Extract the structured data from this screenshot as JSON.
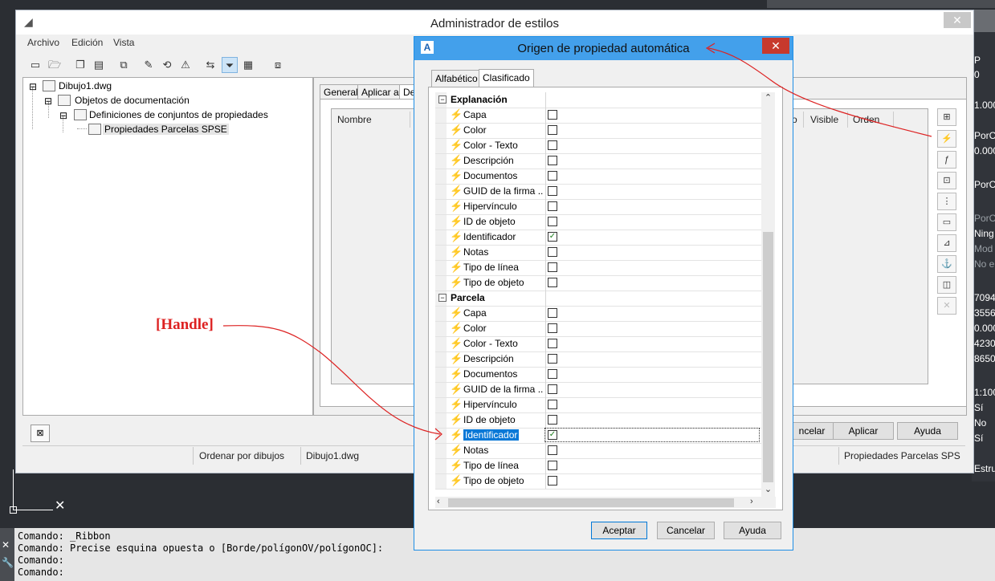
{
  "style_manager": {
    "title": "Administrador de estilos",
    "close_glyph": "✕",
    "menu": [
      "Archivo",
      "Edición",
      "Vista"
    ],
    "toolbar_icons": [
      "new-icon",
      "open-icon",
      "copy-icon",
      "paste-icon",
      "purge-icon",
      "edit-icon",
      "sync-icon",
      "warning-icon",
      "compare-icon",
      "filter-icon",
      "view-options-icon",
      "help-window-icon"
    ],
    "tree": {
      "root": "Dibujo1.dwg",
      "child": "Objetos de documentación",
      "grandchild": "Definiciones de conjuntos de propiedades",
      "selected": "Propiedades Parcelas SPSE"
    },
    "tabs": [
      "General",
      "Aplicar a",
      "De"
    ],
    "grid_headers": {
      "nombre": "Nombre",
      "o": "o",
      "visible": "Visible",
      "orden": "Orden"
    },
    "buttons": {
      "cancel": "ncelar",
      "apply": "Aplicar",
      "help": "Ayuda"
    },
    "status": {
      "sort": "Ordenar por dibujos",
      "file": "Dibujo1.dwg",
      "style": "Propiedades Parcelas SPS"
    }
  },
  "dialog": {
    "title": "Origen de propiedad automática",
    "app_icon_letter": "A",
    "close_glyph": "✕",
    "tabs": [
      "Alfabético",
      "Clasificado"
    ],
    "active_tab": "Clasificado",
    "categories": [
      {
        "name": "Explanación",
        "expander": "−",
        "items": [
          {
            "label": "Capa",
            "mark": ""
          },
          {
            "label": "Color",
            "mark": ""
          },
          {
            "label": "Color - Texto",
            "mark": ""
          },
          {
            "label": "Descripción",
            "mark": ""
          },
          {
            "label": "Documentos",
            "mark": ""
          },
          {
            "label": "GUID de la firma ...",
            "mark": ""
          },
          {
            "label": "Hipervínculo",
            "mark": ""
          },
          {
            "label": "ID de objeto",
            "mark": ""
          },
          {
            "label": "Identificador",
            "mark": "✓"
          },
          {
            "label": "Notas",
            "mark": ""
          },
          {
            "label": "Tipo de línea",
            "mark": ""
          },
          {
            "label": "Tipo de objeto",
            "mark": ""
          }
        ]
      },
      {
        "name": "Parcela",
        "expander": "−",
        "items": [
          {
            "label": "Capa",
            "mark": ""
          },
          {
            "label": "Color",
            "mark": ""
          },
          {
            "label": "Color - Texto",
            "mark": ""
          },
          {
            "label": "Descripción",
            "mark": ""
          },
          {
            "label": "Documentos",
            "mark": ""
          },
          {
            "label": "GUID de la firma ...",
            "mark": ""
          },
          {
            "label": "Hipervínculo",
            "mark": ""
          },
          {
            "label": "ID de objeto",
            "mark": ""
          },
          {
            "label": "Identificador",
            "mark": "✓",
            "selected": true
          },
          {
            "label": "Notas",
            "mark": ""
          },
          {
            "label": "Tipo de línea",
            "mark": ""
          },
          {
            "label": "Tipo de objeto",
            "mark": ""
          }
        ]
      }
    ],
    "buttons": {
      "ok": "Aceptar",
      "cancel": "Cancelar",
      "help": "Ayuda"
    }
  },
  "annotation": {
    "label": "[Handle]",
    "color": "#dd2222"
  },
  "command_line": [
    "Comando: _Ribbon",
    "Comando: Precise esquina opuesta o [Borde/polígonOV/polígonOC]:",
    "Comando:",
    "Comando:"
  ],
  "cad_right_panel": [
    "P",
    "0",
    "1.000",
    "PorC",
    "0.000",
    "PorC",
    "PorC",
    "Ning",
    "Mod",
    "No e",
    "7094",
    "3556",
    "0.000",
    "4230",
    "8650",
    "1:100",
    "Sí",
    "No",
    "Sí",
    "Estru"
  ],
  "colors": {
    "dialog_title_bg": "#43a0eb",
    "dialog_close_bg": "#c7392d",
    "selection": "#0a78d7",
    "annotation": "#dd2222"
  }
}
